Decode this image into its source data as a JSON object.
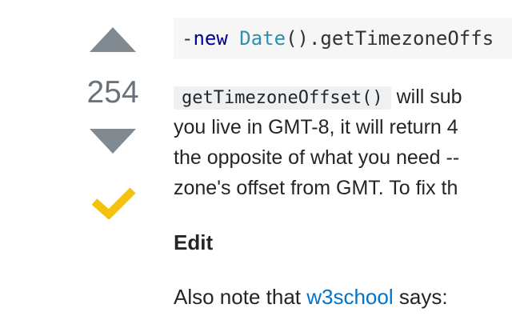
{
  "vote": {
    "count": "254",
    "upvote_label": "",
    "downvote_label": "",
    "accepted_color": "#f4c20d",
    "arrow_color": "#818a91"
  },
  "answer": {
    "code_block": {
      "minus": "-",
      "kw_new": "new",
      "space": " ",
      "type_date": "Date",
      "rest": "().getTimezoneOffs"
    },
    "paragraph": {
      "inline_code": "getTimezoneOffset()",
      "line1_rest": " will sub",
      "line2": "you live in GMT-8, it will return 4",
      "line3": "the opposite of what you need --",
      "line4": "zone's offset from GMT. To fix th"
    },
    "edit_heading": "Edit",
    "also_note": {
      "prefix": "Also note that ",
      "link_text": "w3school",
      "suffix": " says:"
    }
  },
  "icons": {
    "upvote": "upvote-arrow-icon",
    "downvote": "downvote-arrow-icon",
    "accepted": "accepted-checkmark-icon"
  }
}
